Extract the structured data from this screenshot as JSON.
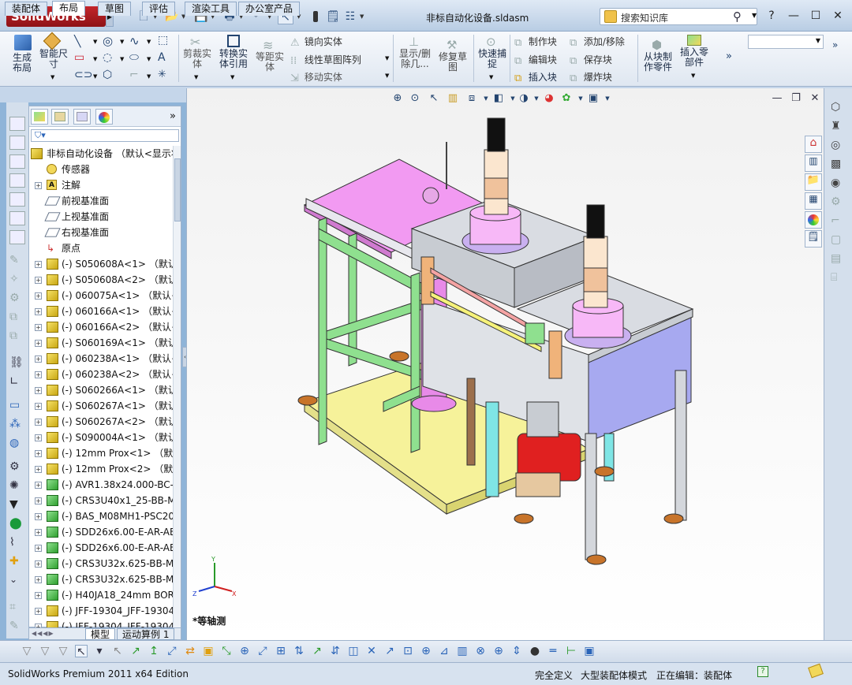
{
  "app": {
    "logo": "SolidWorks",
    "document_title": "非标自动化设备.sldasm"
  },
  "search": {
    "placeholder": "搜索知识库"
  },
  "ribbon": {
    "big_buttons": [
      {
        "label": "生成\n布局",
        "icon": "layout-icon"
      },
      {
        "label": "智能尺\n寸",
        "icon": "smart-dimension-icon"
      },
      {
        "label": "剪裁实\n体",
        "icon": "trim-icon"
      },
      {
        "label": "转换实\n体引用",
        "icon": "convert-entities-icon"
      },
      {
        "label": "等距实\n体",
        "icon": "offset-icon"
      },
      {
        "label": "显示/删\n除几...",
        "icon": "display-relations-icon"
      },
      {
        "label": "修复草\n图",
        "icon": "repair-sketch-icon"
      },
      {
        "label": "快速捕\n捉",
        "icon": "quick-snap-icon"
      },
      {
        "label": "从块制\n作零件",
        "icon": "part-from-block-icon"
      },
      {
        "label": "插入零\n部件",
        "icon": "insert-component-icon"
      }
    ],
    "small_buttons": {
      "mirror": "镜向实体",
      "linear_pattern": "线性草图阵列",
      "move": "移动实体",
      "make_block": "制作块",
      "edit_block": "编辑块",
      "insert_block": "插入块",
      "add_remove": "添加/移除",
      "save_block": "保存块",
      "explode_block": "爆炸块"
    }
  },
  "tabs": [
    "装配体",
    "布局",
    "草图",
    "评估",
    "渲染工具",
    "办公室产品"
  ],
  "active_tab": "布局",
  "tree": {
    "root": "非标自动化设备 （默认<显示状",
    "items": [
      {
        "text": "传感器",
        "icon": "sensor",
        "expand": false
      },
      {
        "text": "注解",
        "icon": "annotation",
        "expand": true
      },
      {
        "text": "前视基准面",
        "icon": "plane",
        "expand": false
      },
      {
        "text": "上视基准面",
        "icon": "plane",
        "expand": false
      },
      {
        "text": "右视基准面",
        "icon": "plane",
        "expand": false
      },
      {
        "text": "原点",
        "icon": "origin",
        "expand": false
      },
      {
        "text": "(-) S050608A<1> （默认<",
        "icon": "part",
        "expand": true
      },
      {
        "text": "(-) S050608A<2> （默认<",
        "icon": "part",
        "expand": true
      },
      {
        "text": "(-) 060075A<1> （默认<-",
        "icon": "part",
        "expand": true
      },
      {
        "text": "(-) 060166A<1> （默认<-",
        "icon": "part",
        "expand": true
      },
      {
        "text": "(-) 060166A<2> （默认<-",
        "icon": "part",
        "expand": true
      },
      {
        "text": "(-) S060169A<1> （默认<",
        "icon": "part",
        "expand": true
      },
      {
        "text": "(-) 060238A<1> （默认<-",
        "icon": "part",
        "expand": true
      },
      {
        "text": "(-) 060238A<2> （默认<-",
        "icon": "part",
        "expand": true
      },
      {
        "text": "(-) S060266A<1> （默认<",
        "icon": "part",
        "expand": true
      },
      {
        "text": "(-) S060267A<1> （默认<",
        "icon": "part",
        "expand": true
      },
      {
        "text": "(-) S060267A<2> （默认<",
        "icon": "part",
        "expand": true
      },
      {
        "text": "(-) S090004A<1> （默认<",
        "icon": "part",
        "expand": true
      },
      {
        "text": "(-) 12mm Prox<1> （默认",
        "icon": "part",
        "expand": true
      },
      {
        "text": "(-) 12mm Prox<2> （默认",
        "icon": "part",
        "expand": true
      },
      {
        "text": "(-) AVR1.38x24.000-BC-I",
        "icon": "part-g",
        "expand": true
      },
      {
        "text": "(-) CRS3U40x1_25-BB-M",
        "icon": "part-g",
        "expand": true
      },
      {
        "text": "(-) BAS_M08MH1-PSC20",
        "icon": "part-g",
        "expand": true
      },
      {
        "text": "(-) SDD26x6.00-E-AR-AE",
        "icon": "part-g",
        "expand": true
      },
      {
        "text": "(-) SDD26x6.00-E-AR-AE",
        "icon": "part-g",
        "expand": true
      },
      {
        "text": "(-) CRS3U32x.625-BB-M",
        "icon": "part-g",
        "expand": true
      },
      {
        "text": "(-) CRS3U32x.625-BB-M",
        "icon": "part-g",
        "expand": true
      },
      {
        "text": "(-) H40JA18_24mm BOR",
        "icon": "part-g",
        "expand": true
      },
      {
        "text": "(-) JFF-19304_JFF-19304",
        "icon": "part",
        "expand": true
      },
      {
        "text": "(-) JFF-19304_JFF-19304",
        "icon": "part",
        "expand": true
      }
    ]
  },
  "bottom_tabs": [
    "模型",
    "运动算例 1"
  ],
  "view_label": "*等轴测",
  "triad": {
    "x": "X",
    "y": "Y",
    "z": "Z"
  },
  "status": {
    "app_edition": "SolidWorks Premium 2011 x64 Edition",
    "definition": "完全定义",
    "mode": "大型装配体模式",
    "editing": "正在编辑：装配体"
  },
  "colors": {
    "frame_green": "#8fe08f",
    "plate_magenta": "#f29af2",
    "base_yellow": "#f6f29a",
    "steel_gray": "#c8ccd2",
    "motor_red": "#e02020",
    "panel_blue": "#a7a9f0",
    "cyan_post": "#7fe5e5",
    "accent_orange": "#f0b37a",
    "brand_red": "#c4262b"
  }
}
